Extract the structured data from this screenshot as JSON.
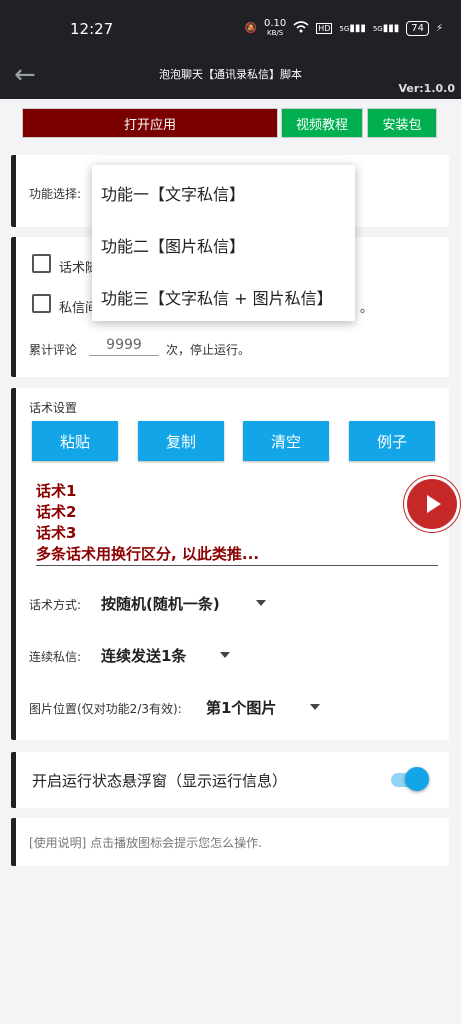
{
  "status": {
    "time": "12:27",
    "net_speed": "0.10",
    "net_unit": "KB/S",
    "hd": "HD",
    "sig1": "5G",
    "sig2": "5G",
    "battery": "74"
  },
  "appbar": {
    "title": "泡泡聊天【通讯录私信】脚本",
    "version": "Ver:1.0.0"
  },
  "toolbar": {
    "open_app": "打开应用",
    "video_tutorial": "视频教程",
    "install_pkg": "安装包"
  },
  "function_select": {
    "label": "功能选择:"
  },
  "dropdown": {
    "items": [
      "功能一【文字私信】",
      "功能二【图片私信】",
      "功能三【文字私信 + 图片私信】"
    ]
  },
  "options": {
    "checkbox1_label": "话术随",
    "checkbox2_label": "私信间",
    "checkbox2_tail": "。",
    "cumulative_prefix": "累计评论",
    "cumulative_value": "9999",
    "cumulative_suffix": "次，停止运行。"
  },
  "script_settings": {
    "title": "话术设置",
    "buttons": [
      "粘贴",
      "复制",
      "清空",
      "例子"
    ],
    "lines": [
      "话术1",
      "话术2",
      "话术3",
      "多条话术用换行区分, 以此类推..."
    ],
    "mode_label": "话术方式:",
    "mode_value": "按随机(随机一条)",
    "continuous_label": "连续私信:",
    "continuous_value": "连续发送1条",
    "image_pos_label": "图片位置(仅对功能2/3有效):",
    "image_pos_value": "第1个图片"
  },
  "floating": {
    "label": "开启运行状态悬浮窗（显示运行信息）",
    "enabled": true
  },
  "instructions": {
    "text": "[使用说明] 点击播放图标会提示您怎么操作."
  },
  "colors": {
    "accent": "#12a6e9",
    "open_btn": "#7a0000",
    "green_btn": "#00b050",
    "script_text": "#8b0000"
  }
}
